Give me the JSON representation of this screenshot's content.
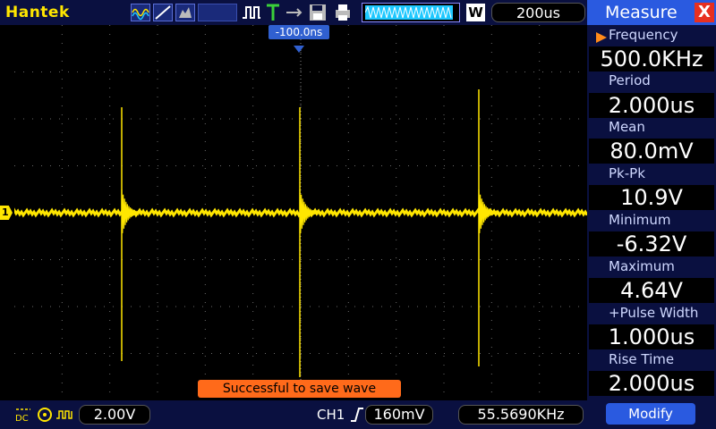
{
  "topbar": {
    "brand": "Hantek",
    "timebase": "200us",
    "w_badge": "W"
  },
  "screen": {
    "trigger_offset": "-100.0ns",
    "ch1_marker": "1",
    "toast": "Successful to save wave"
  },
  "bottombar": {
    "volts_div": "2.00V",
    "channel": "CH1",
    "trigger_level": "160mV",
    "counter_freq": "55.5690KHz"
  },
  "measure": {
    "title": "Measure",
    "close": "X",
    "items": [
      {
        "label": "Frequency",
        "value": "500.0KHz"
      },
      {
        "label": "Period",
        "value": "2.000us"
      },
      {
        "label": "Mean",
        "value": "80.0mV"
      },
      {
        "label": "Pk-Pk",
        "value": "10.9V"
      },
      {
        "label": "Minimum",
        "value": "-6.32V"
      },
      {
        "label": "Maximum",
        "value": "4.64V"
      },
      {
        "label": "+Pulse Width",
        "value": "1.000us"
      },
      {
        "label": "Rise Time",
        "value": "2.000us"
      }
    ],
    "modify": "Modify"
  },
  "colors": {
    "trace": "#ffe600",
    "toolbar_bg": "#0a1040",
    "panel_head": "#2a5ae0",
    "toast": "#ff6a1a"
  }
}
